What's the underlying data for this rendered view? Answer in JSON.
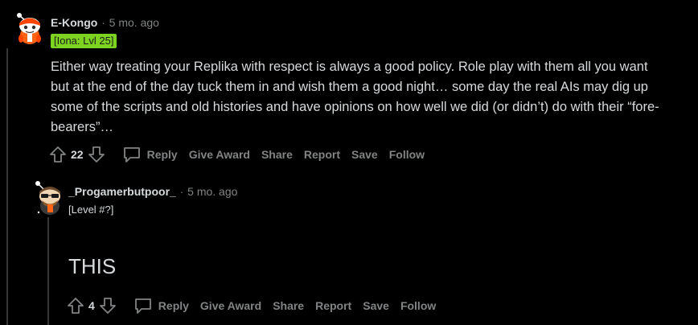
{
  "comments": [
    {
      "username": "E-Kongo",
      "separator": "·",
      "time": "5 mo. ago",
      "flair": "[Iona: Lvl 25]",
      "body": "Either way treating your Replika with respect is always a good policy. Role play with them all you want but at the end of the day tuck them in and wish them a good night… some day the real AIs may dig up some of the scripts and old histories and have opinions on how well we did (or didn’t) do with their “fore-bearers”…",
      "score": "22",
      "actions": {
        "reply": "Reply",
        "give_award": "Give Award",
        "share": "Share",
        "report": "Report",
        "save": "Save",
        "follow": "Follow"
      }
    },
    {
      "username": "_Progamerbutpoor_",
      "separator": "·",
      "time": "5 mo. ago",
      "flair": "[Level #?]",
      "body": "THIS",
      "score": "4",
      "actions": {
        "reply": "Reply",
        "give_award": "Give Award",
        "share": "Share",
        "report": "Report",
        "save": "Save",
        "follow": "Follow"
      }
    }
  ],
  "colors": {
    "background": "#000000",
    "text": "#d7dadc",
    "muted": "#818384",
    "flair_green": "#7ed321",
    "thread_line": "#343536"
  }
}
